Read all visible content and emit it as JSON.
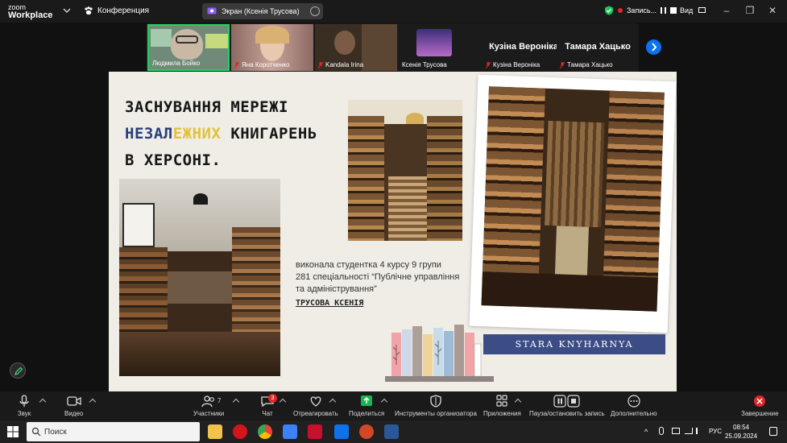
{
  "app": {
    "brand_line1": "zoom",
    "brand_line2": "Workplace",
    "meeting_menu": "Конференция"
  },
  "share": {
    "label": "Экран (Ксенія Трусова)"
  },
  "recording": {
    "label": "Запись..."
  },
  "view": {
    "label": "Вид"
  },
  "participants_strip": [
    {
      "name": "Людмила Бойко",
      "muted": false,
      "active": true
    },
    {
      "name": "Яна Коротченко",
      "muted": true
    },
    {
      "name": "Kandala Irina",
      "muted": true
    },
    {
      "name": "Ксенія Трусова",
      "muted": false
    },
    {
      "name": "Кузіна Вероніка",
      "display": "Кузіна Вероніка",
      "muted": true
    },
    {
      "name": "Тамара Хацько",
      "display": "Тамара Хацько",
      "muted": true
    }
  ],
  "slide": {
    "title_line1": "ЗАСНУВАННЯ МЕРЕЖІ",
    "title_line2_a": "НЕЗАЛ",
    "title_line2_b": "ЕЖНИХ",
    "title_line2_c": " КНИГАРЕНЬ",
    "title_line3": "В ХЕРСОНІ.",
    "credit_line1": "виконала студентка 4 курсу 9 групи",
    "credit_line2": "281 спеціальності “Публічне управління",
    "credit_line3": "та адміністрування”",
    "author": "ТРУСОВА КСЕНІЯ",
    "banner": "STARA KNYHARNYA"
  },
  "toolbar": {
    "audio": "Звук",
    "video": "Видео",
    "participants": "Участники",
    "participants_count": "7",
    "chat": "Чат",
    "chat_badge": "3",
    "react": "Отреагировать",
    "share": "Поделиться",
    "host_tools": "Инструменты организатора",
    "apps": "Приложения",
    "pause_record": "Пауза/остановить запись",
    "more": "Дополнительно",
    "end": "Завершение"
  },
  "taskbar": {
    "search_placeholder": "Поиск",
    "lang": "РУС",
    "time": "08:54",
    "date": "25.09.2024"
  },
  "colors": {
    "accent_blue": "#0e72ed",
    "title_blue": "#2a3e7c",
    "title_yellow": "#e2c23c",
    "banner_bg": "#3c4d85",
    "end_red": "#e02828",
    "share_green": "#17b651"
  }
}
